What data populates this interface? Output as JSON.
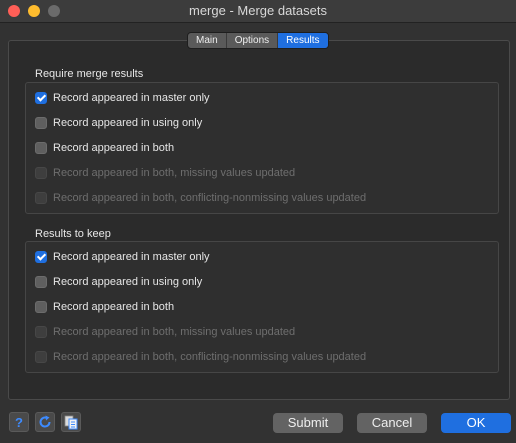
{
  "window": {
    "title": "merge - Merge datasets"
  },
  "tabs": [
    {
      "label": "Main"
    },
    {
      "label": "Options"
    },
    {
      "label": "Results"
    }
  ],
  "require": {
    "title": "Require merge results",
    "options": [
      {
        "label": "Record appeared in master only",
        "checked": true,
        "enabled": true
      },
      {
        "label": "Record appeared in using only",
        "checked": false,
        "enabled": true
      },
      {
        "label": "Record appeared in both",
        "checked": false,
        "enabled": true
      },
      {
        "label": "Record appeared in both, missing values updated",
        "checked": false,
        "enabled": false
      },
      {
        "label": "Record appeared in both, conflicting-nonmissing values updated",
        "checked": false,
        "enabled": false
      }
    ]
  },
  "keep": {
    "title": "Results to keep",
    "options": [
      {
        "label": "Record appeared in master only",
        "checked": true,
        "enabled": true
      },
      {
        "label": "Record appeared in using only",
        "checked": false,
        "enabled": true
      },
      {
        "label": "Record appeared in both",
        "checked": false,
        "enabled": true
      },
      {
        "label": "Record appeared in both, missing values updated",
        "checked": false,
        "enabled": false
      },
      {
        "label": "Record appeared in both, conflicting-nonmissing values updated",
        "checked": false,
        "enabled": false
      }
    ]
  },
  "footer": {
    "icons": [
      "help-icon",
      "reset-icon",
      "copy-command-icon"
    ],
    "submit_label": "Submit",
    "cancel_label": "Cancel",
    "ok_label": "OK"
  },
  "colors": {
    "accent": "#1f6fe0",
    "background": "#323232"
  }
}
